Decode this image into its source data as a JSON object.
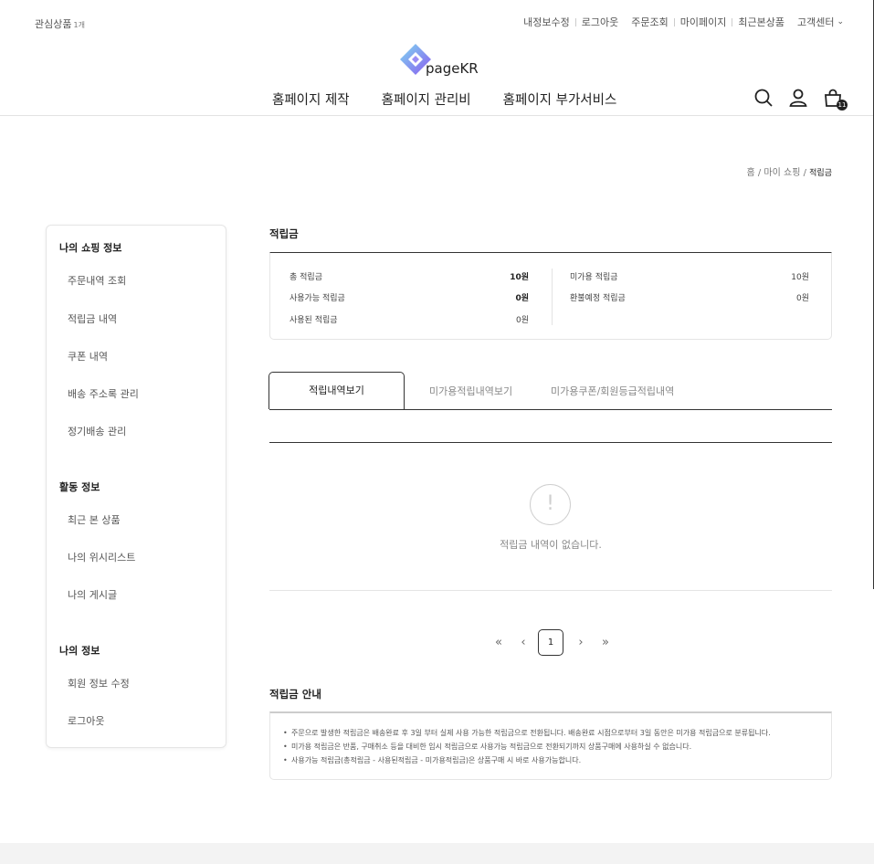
{
  "util": {
    "wishlist_label": "관심상품",
    "wishlist_count": "1개",
    "links": [
      "내정보수정",
      "로그아웃",
      "주문조회",
      "마이페이지",
      "최근본상품"
    ],
    "support": "고객센터"
  },
  "logo": {
    "text": "pageKR"
  },
  "gnb": [
    "홈페이지 제작",
    "홈페이지 관리비",
    "홈페이지 부가서비스"
  ],
  "cart_count": "11",
  "breadcrumb": {
    "home": "홈",
    "mypage": "마이 쇼핑",
    "current": "적립금",
    "sep": "/"
  },
  "sidebar": {
    "group1": {
      "title": "나의 쇼핑 정보",
      "items": [
        "주문내역 조회",
        "적립금 내역",
        "쿠폰 내역",
        "배송 주소록 관리",
        "정기배송 관리"
      ]
    },
    "group2": {
      "title": "활동 정보",
      "items": [
        "최근 본 상품",
        "나의 위시리스트",
        "나의 게시글"
      ]
    },
    "group3": {
      "title": "나의 정보",
      "items": [
        "회원 정보 수정",
        "로그아웃"
      ]
    }
  },
  "mileage": {
    "title": "적립금",
    "rows": [
      {
        "label": "총 적립금",
        "value": "10원"
      },
      {
        "label": "사용가능 적립금",
        "value": "0원"
      },
      {
        "label": "사용된 적립금",
        "value": "0원"
      },
      {
        "label": "미가용 적립금",
        "value": "10원"
      },
      {
        "label": "환불예정 적립금",
        "value": "0원"
      }
    ]
  },
  "tabs": [
    "적립내역보기",
    "미가용적립내역보기",
    "미가용쿠폰/회원등급적립내역"
  ],
  "empty": {
    "icon": "!",
    "message": "적립금 내역이 없습니다."
  },
  "paging": {
    "first": "«",
    "prev": "‹",
    "current": "1",
    "next": "›",
    "last": "»"
  },
  "guide": {
    "title": "적립금 안내",
    "items": [
      "주문으로 발생한 적립금은 배송완료 후 3일 부터 실제 사용 가능한 적립금으로 전환됩니다. 배송완료 시점으로부터 3일 동안은 미가용 적립금으로 분류됩니다.",
      "미가용 적립금은 반품, 구매취소 등을 대비한 임시 적립금으로 사용가능 적립금으로 전환되기까지 상품구매에 사용하실 수 없습니다.",
      "사용가능 적립금(총적립금 - 사용된적립금 - 미가용적립금)은 상품구매 시 바로 사용가능합니다."
    ]
  }
}
